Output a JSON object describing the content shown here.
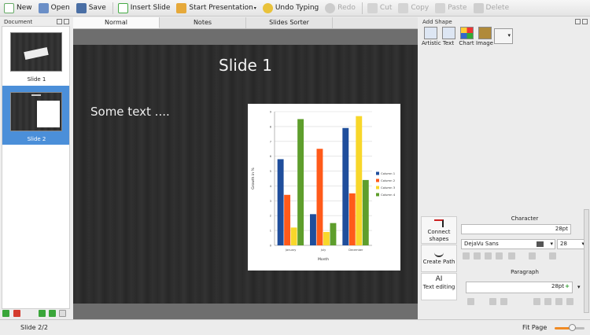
{
  "toolbar": {
    "items": [
      {
        "label": "New",
        "icon": "new-document-icon",
        "enabled": true
      },
      {
        "label": "Open",
        "icon": "open-folder-icon",
        "enabled": true
      },
      {
        "label": "Save",
        "icon": "save-icon",
        "enabled": true
      },
      {
        "label": "Insert Slide",
        "icon": "insert-slide-icon",
        "enabled": true
      },
      {
        "label": "Start Presentation",
        "icon": "start-presentation-icon",
        "enabled": true
      },
      {
        "label": "Undo Typing",
        "icon": "undo-icon",
        "enabled": true
      },
      {
        "label": "Redo",
        "icon": "redo-icon",
        "enabled": false
      },
      {
        "label": "Cut",
        "icon": "cut-icon",
        "enabled": false
      },
      {
        "label": "Copy",
        "icon": "copy-icon",
        "enabled": false
      },
      {
        "label": "Paste",
        "icon": "paste-icon",
        "enabled": false
      },
      {
        "label": "Delete",
        "icon": "delete-icon",
        "enabled": false
      }
    ]
  },
  "document_panel": {
    "title": "Document",
    "slides": [
      {
        "label": "Slide 1"
      },
      {
        "label": "Slide 2",
        "selected": true
      }
    ]
  },
  "tabs": [
    {
      "label": "Normal",
      "active": true
    },
    {
      "label": "Notes"
    },
    {
      "label": "Slides Sorter"
    }
  ],
  "slide": {
    "title": "Slide 1",
    "text": "Some text ...."
  },
  "add_shape": {
    "title": "Add Shape",
    "items": [
      "Artistic",
      "Text",
      "Chart",
      "Image"
    ]
  },
  "tools": [
    "Connect shapes",
    "Create Path",
    "Text editing"
  ],
  "character": {
    "title": "Character",
    "size_field": "28pt",
    "font_family": "DejaVu Sans",
    "font_size": "28"
  },
  "paragraph": {
    "title": "Paragraph",
    "size_field": "28pt"
  },
  "status": {
    "slide": "Slide 2/2",
    "zoom": "Fit Page"
  },
  "colors": {
    "series": [
      "#1f4e9c",
      "#ff5a1a",
      "#f8d72a",
      "#5e9e2c"
    ],
    "selection": "#4b8fd9"
  },
  "chart_data": {
    "type": "bar",
    "categories": [
      "January",
      "July",
      "December"
    ],
    "series": [
      {
        "name": "Column 1",
        "values": [
          5.8,
          2.1,
          7.9
        ]
      },
      {
        "name": "Column 2",
        "values": [
          3.4,
          6.5,
          3.5
        ]
      },
      {
        "name": "Column 3",
        "values": [
          1.2,
          0.9,
          8.7
        ]
      },
      {
        "name": "Column 4",
        "values": [
          8.5,
          1.5,
          4.4
        ]
      }
    ],
    "xlabel": "Month",
    "ylabel": "Growth in %",
    "ylim": [
      0,
      9
    ],
    "yticks": [
      "0",
      "1",
      "2",
      "3",
      "4",
      "5",
      "6",
      "7",
      "8",
      "9"
    ],
    "legend": "right",
    "grid": true
  }
}
